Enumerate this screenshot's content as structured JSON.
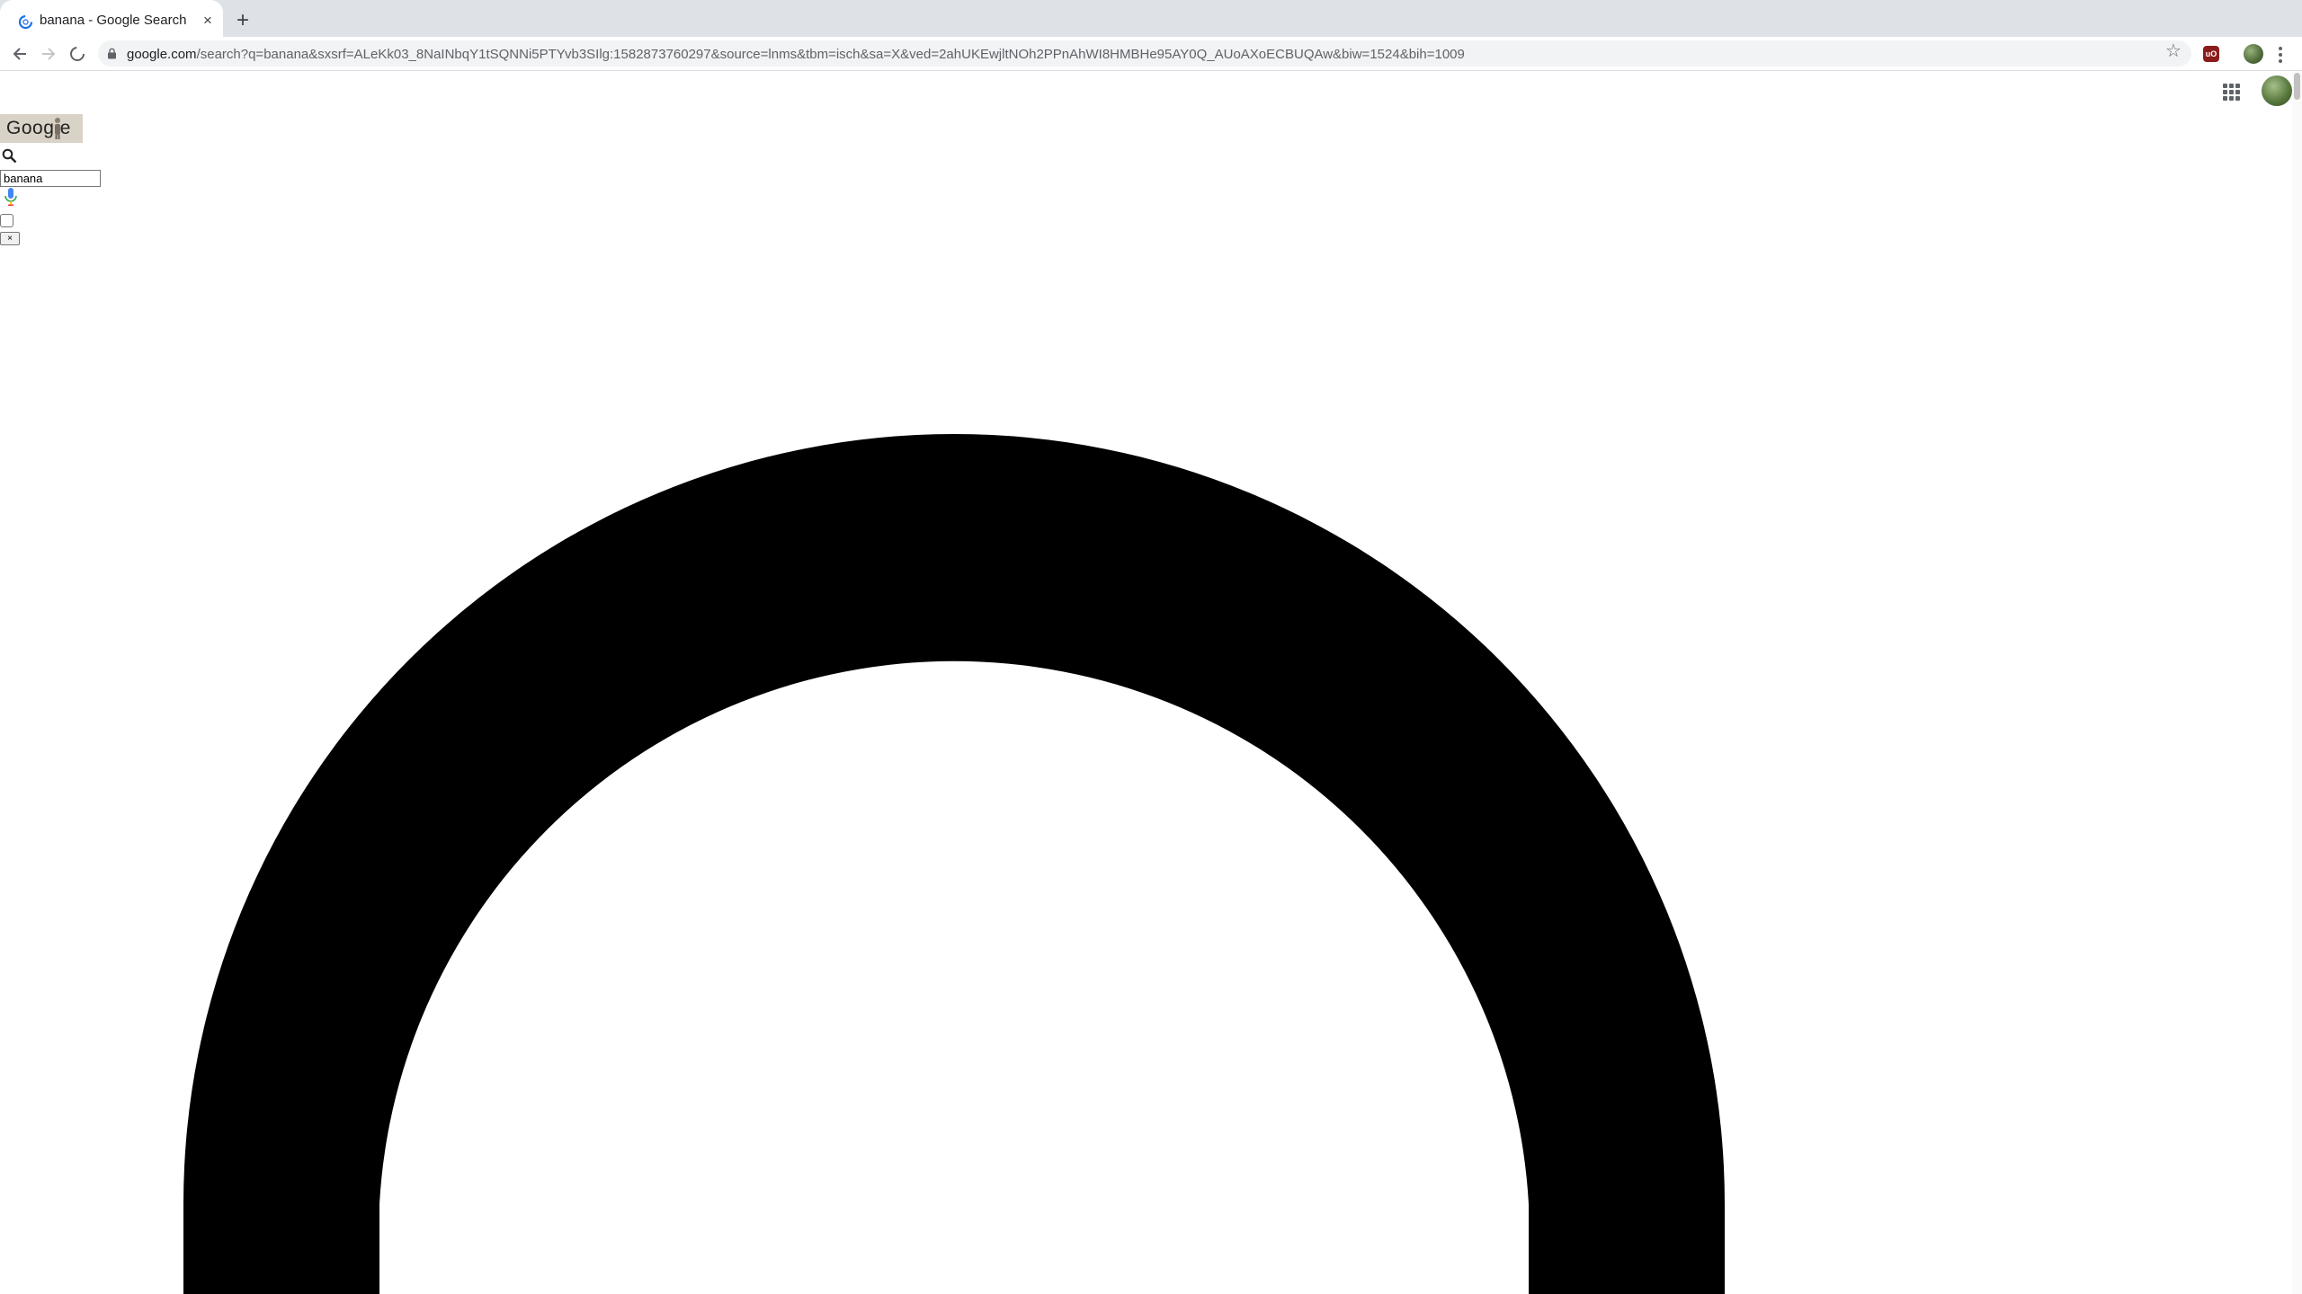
{
  "browser": {
    "tab": {
      "title": "banana - Google Search"
    },
    "address_bar": {
      "host": "google.com",
      "path": "/search?q=banana&sxsrf=ALeKk03_8NaINbqY1tSQNNi5PTYvb3SIlg:1582873760297&source=lnms&tbm=isch&sa=X&ved=2ahUKEwjltNOh2PPnAhWI8HMBHe95AY0Q_AUoAXoECBUQAw&biw=1524&bih=1009"
    },
    "icons": {
      "favicon": "google-favicon",
      "back": "back-arrow-icon",
      "forward": "forward-arrow-icon",
      "reload": "loading-spinner-icon",
      "lock": "lock-icon",
      "bookmark": "star-icon",
      "extension": "ublock-shield-icon",
      "profile": "profile-avatar",
      "menu": "vertical-dots-icon",
      "new_tab": "plus-icon",
      "close_tab": "close-icon"
    }
  },
  "page": {
    "logo": {
      "text": "Goog e"
    },
    "search": {
      "value": "banana"
    },
    "clear_button": {
      "label": "×"
    },
    "icons": {
      "apps": "apps-grid-icon",
      "search": "search-icon",
      "mic": "microphone-icon",
      "loading": "loading-spinner-ring"
    }
  },
  "colors": {
    "tabstrip": "#dee1e6",
    "omnibox": "#f1f3f4",
    "spinner": "#000000",
    "logo_background": "#d9d2c6"
  }
}
